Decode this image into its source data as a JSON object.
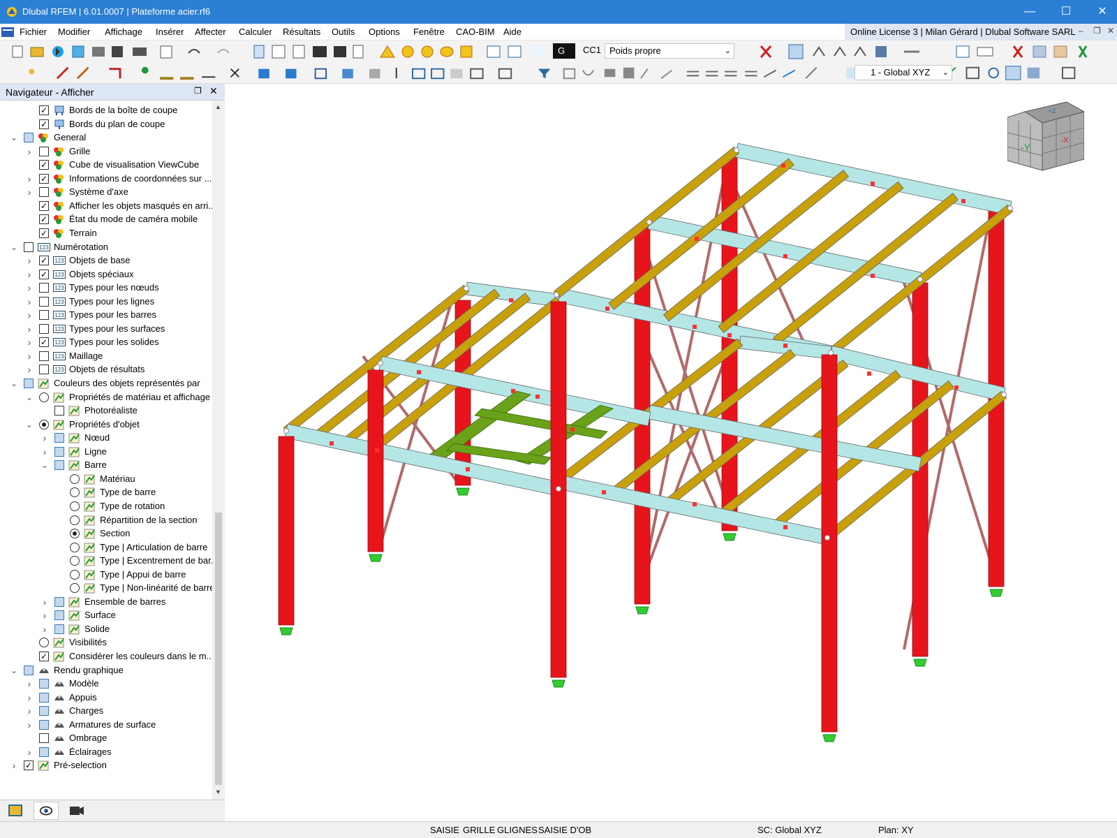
{
  "window": {
    "title": "Dlubal RFEM | 6.01.0007 | Plateforme acier.rf6",
    "controls": [
      "minimize",
      "maximize",
      "close"
    ]
  },
  "menu": {
    "items": [
      "Fichier",
      "Modifier",
      "Affichage",
      "Insérer",
      "Affecter",
      "Calculer",
      "Résultats",
      "Outils",
      "Options",
      "Fenêtre",
      "CAO-BIM",
      "Aide"
    ],
    "license": "Online License 3 | Milan Gérard | Dlubal Software SARL"
  },
  "toolbar": {
    "loadcase_badge": "G",
    "loadcase_id": "CC1",
    "loadcase_name": "Poids propre",
    "coordinate_system": "1 - Global XYZ"
  },
  "navigator": {
    "title": "Navigateur - Afficher",
    "items": [
      {
        "label": "Bords de la boîte de coupe",
        "level": 1,
        "expander": "",
        "control": "checked",
        "icon": "clipping-box-icon"
      },
      {
        "label": "Bords du plan de coupe",
        "level": 1,
        "expander": "",
        "control": "checked",
        "icon": "clipping-plane-icon"
      },
      {
        "label": "General",
        "level": 0,
        "expander": "v",
        "control": "partial",
        "icon": "general-icon"
      },
      {
        "label": "Grille",
        "level": 1,
        "expander": ">",
        "control": "unchecked",
        "icon": "general-icon"
      },
      {
        "label": "Cube de visualisation ViewCube",
        "level": 1,
        "expander": "",
        "control": "checked",
        "icon": "general-icon"
      },
      {
        "label": "Informations de coordonnées sur ...",
        "level": 1,
        "expander": ">",
        "control": "checked",
        "icon": "general-icon"
      },
      {
        "label": "Système d'axe",
        "level": 1,
        "expander": ">",
        "control": "unchecked",
        "icon": "general-icon"
      },
      {
        "label": "Afficher les objets masqués en arri...",
        "level": 1,
        "expander": "",
        "control": "checked",
        "icon": "general-icon"
      },
      {
        "label": "État du mode de caméra mobile",
        "level": 1,
        "expander": "",
        "control": "checked",
        "icon": "general-icon"
      },
      {
        "label": "Terrain",
        "level": 1,
        "expander": "",
        "control": "checked",
        "icon": "general-icon"
      },
      {
        "label": "Numérotation",
        "level": 0,
        "expander": "v",
        "control": "unchecked",
        "icon": "numbering-icon"
      },
      {
        "label": "Objets de base",
        "level": 1,
        "expander": ">",
        "control": "checked",
        "icon": "numbering-icon"
      },
      {
        "label": "Objets spéciaux",
        "level": 1,
        "expander": ">",
        "control": "checked",
        "icon": "numbering-icon"
      },
      {
        "label": "Types pour les nœuds",
        "level": 1,
        "expander": ">",
        "control": "unchecked",
        "icon": "numbering-icon"
      },
      {
        "label": "Types pour les lignes",
        "level": 1,
        "expander": ">",
        "control": "unchecked",
        "icon": "numbering-icon"
      },
      {
        "label": "Types pour les barres",
        "level": 1,
        "expander": ">",
        "control": "unchecked",
        "icon": "numbering-icon"
      },
      {
        "label": "Types pour les surfaces",
        "level": 1,
        "expander": ">",
        "control": "unchecked",
        "icon": "numbering-icon"
      },
      {
        "label": "Types pour les solides",
        "level": 1,
        "expander": ">",
        "control": "checked",
        "icon": "numbering-icon"
      },
      {
        "label": "Maillage",
        "level": 1,
        "expander": ">",
        "control": "unchecked",
        "icon": "numbering-icon"
      },
      {
        "label": "Objets de résultats",
        "level": 1,
        "expander": ">",
        "control": "unchecked",
        "icon": "numbering-icon"
      },
      {
        "label": "Couleurs des objets représentés par",
        "level": 0,
        "expander": "v",
        "control": "partial",
        "icon": "color-icon"
      },
      {
        "label": "Propriétés de matériau et affichage",
        "level": 1,
        "expander": "v",
        "control": "radio-off",
        "icon": "color-icon"
      },
      {
        "label": "Photoréaliste",
        "level": 2,
        "expander": "",
        "control": "unchecked",
        "icon": "color-icon"
      },
      {
        "label": "Propriétés d'objet",
        "level": 1,
        "expander": "v",
        "control": "radio-on",
        "icon": "color-icon"
      },
      {
        "label": "Nœud",
        "level": 2,
        "expander": ">",
        "control": "partial",
        "icon": "color-icon"
      },
      {
        "label": "Ligne",
        "level": 2,
        "expander": ">",
        "control": "partial",
        "icon": "color-icon"
      },
      {
        "label": "Barre",
        "level": 2,
        "expander": "v",
        "control": "partial",
        "icon": "color-icon"
      },
      {
        "label": "Matériau",
        "level": 3,
        "expander": "",
        "control": "radio-off",
        "icon": "color-icon"
      },
      {
        "label": "Type de barre",
        "level": 3,
        "expander": "",
        "control": "radio-off",
        "icon": "color-icon"
      },
      {
        "label": "Type de rotation",
        "level": 3,
        "expander": "",
        "control": "radio-off",
        "icon": "color-icon"
      },
      {
        "label": "Répartition de la section",
        "level": 3,
        "expander": "",
        "control": "radio-off",
        "icon": "color-icon"
      },
      {
        "label": "Section",
        "level": 3,
        "expander": "",
        "control": "radio-on",
        "icon": "color-icon"
      },
      {
        "label": "Type | Articulation de barre",
        "level": 3,
        "expander": "",
        "control": "radio-off",
        "icon": "color-icon"
      },
      {
        "label": "Type | Excentrement de bar...",
        "level": 3,
        "expander": "",
        "control": "radio-off",
        "icon": "color-icon"
      },
      {
        "label": "Type | Appui de barre",
        "level": 3,
        "expander": "",
        "control": "radio-off",
        "icon": "color-icon"
      },
      {
        "label": "Type | Non-linéarité de barre",
        "level": 3,
        "expander": "",
        "control": "radio-off",
        "icon": "color-icon"
      },
      {
        "label": "Ensemble de barres",
        "level": 2,
        "expander": ">",
        "control": "partial",
        "icon": "color-icon"
      },
      {
        "label": "Surface",
        "level": 2,
        "expander": ">",
        "control": "partial",
        "icon": "color-icon"
      },
      {
        "label": "Solide",
        "level": 2,
        "expander": ">",
        "control": "partial",
        "icon": "color-icon"
      },
      {
        "label": "Visibilités",
        "level": 1,
        "expander": "",
        "control": "radio-off",
        "icon": "color-icon"
      },
      {
        "label": "Considérer les couleurs dans le m...",
        "level": 1,
        "expander": "",
        "control": "checked",
        "icon": "color-icon"
      },
      {
        "label": "Rendu graphique",
        "level": 0,
        "expander": "v",
        "control": "partial",
        "icon": "render-icon"
      },
      {
        "label": "Modèle",
        "level": 1,
        "expander": ">",
        "control": "partial",
        "icon": "render-icon"
      },
      {
        "label": "Appuis",
        "level": 1,
        "expander": ">",
        "control": "partial",
        "icon": "render-icon"
      },
      {
        "label": "Charges",
        "level": 1,
        "expander": ">",
        "control": "partial",
        "icon": "render-icon"
      },
      {
        "label": "Armatures de surface",
        "level": 1,
        "expander": ">",
        "control": "partial",
        "icon": "render-icon"
      },
      {
        "label": "Ombrage",
        "level": 1,
        "expander": "",
        "control": "unchecked",
        "icon": "render-icon"
      },
      {
        "label": "Éclairages",
        "level": 1,
        "expander": ">",
        "control": "partial",
        "icon": "render-icon"
      },
      {
        "label": "Pré-selection",
        "level": 0,
        "expander": ">",
        "control": "checked",
        "icon": "color-icon"
      }
    ],
    "tabs": [
      "data-tab-icon",
      "display-tab-icon",
      "views-tab-icon"
    ]
  },
  "viewcube": {
    "face_label": "-Y",
    "side_label": "-X",
    "top_label": "+Z"
  },
  "status": {
    "modes": [
      "SAISIE",
      "GRILLE",
      "GLIGNES",
      "SAISIE D'OB"
    ],
    "cs": "SC: Global XYZ",
    "plane": "Plan: XY"
  },
  "colors": {
    "title_bar": "#2b7fd4",
    "column": "#e8141c",
    "beam": "#b4e6e6",
    "purlin": "#c8a00a",
    "bracing": "#b26a6a",
    "platform": "#6aa21a",
    "support": "#33cc33",
    "node_hinge": "#ff3030"
  }
}
